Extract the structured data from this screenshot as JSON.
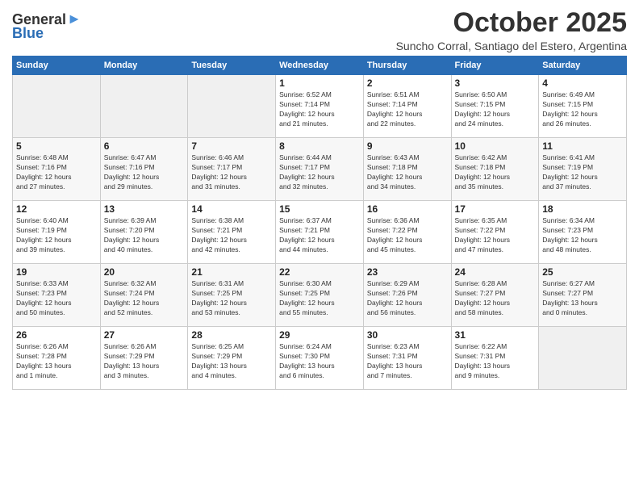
{
  "app": {
    "logo_line1": "General",
    "logo_line2": "Blue"
  },
  "header": {
    "month": "October 2025",
    "location": "Suncho Corral, Santiago del Estero, Argentina"
  },
  "days_of_week": [
    "Sunday",
    "Monday",
    "Tuesday",
    "Wednesday",
    "Thursday",
    "Friday",
    "Saturday"
  ],
  "weeks": [
    [
      {
        "day": "",
        "info": ""
      },
      {
        "day": "",
        "info": ""
      },
      {
        "day": "",
        "info": ""
      },
      {
        "day": "1",
        "info": "Sunrise: 6:52 AM\nSunset: 7:14 PM\nDaylight: 12 hours\nand 21 minutes."
      },
      {
        "day": "2",
        "info": "Sunrise: 6:51 AM\nSunset: 7:14 PM\nDaylight: 12 hours\nand 22 minutes."
      },
      {
        "day": "3",
        "info": "Sunrise: 6:50 AM\nSunset: 7:15 PM\nDaylight: 12 hours\nand 24 minutes."
      },
      {
        "day": "4",
        "info": "Sunrise: 6:49 AM\nSunset: 7:15 PM\nDaylight: 12 hours\nand 26 minutes."
      }
    ],
    [
      {
        "day": "5",
        "info": "Sunrise: 6:48 AM\nSunset: 7:16 PM\nDaylight: 12 hours\nand 27 minutes."
      },
      {
        "day": "6",
        "info": "Sunrise: 6:47 AM\nSunset: 7:16 PM\nDaylight: 12 hours\nand 29 minutes."
      },
      {
        "day": "7",
        "info": "Sunrise: 6:46 AM\nSunset: 7:17 PM\nDaylight: 12 hours\nand 31 minutes."
      },
      {
        "day": "8",
        "info": "Sunrise: 6:44 AM\nSunset: 7:17 PM\nDaylight: 12 hours\nand 32 minutes."
      },
      {
        "day": "9",
        "info": "Sunrise: 6:43 AM\nSunset: 7:18 PM\nDaylight: 12 hours\nand 34 minutes."
      },
      {
        "day": "10",
        "info": "Sunrise: 6:42 AM\nSunset: 7:18 PM\nDaylight: 12 hours\nand 35 minutes."
      },
      {
        "day": "11",
        "info": "Sunrise: 6:41 AM\nSunset: 7:19 PM\nDaylight: 12 hours\nand 37 minutes."
      }
    ],
    [
      {
        "day": "12",
        "info": "Sunrise: 6:40 AM\nSunset: 7:19 PM\nDaylight: 12 hours\nand 39 minutes."
      },
      {
        "day": "13",
        "info": "Sunrise: 6:39 AM\nSunset: 7:20 PM\nDaylight: 12 hours\nand 40 minutes."
      },
      {
        "day": "14",
        "info": "Sunrise: 6:38 AM\nSunset: 7:21 PM\nDaylight: 12 hours\nand 42 minutes."
      },
      {
        "day": "15",
        "info": "Sunrise: 6:37 AM\nSunset: 7:21 PM\nDaylight: 12 hours\nand 44 minutes."
      },
      {
        "day": "16",
        "info": "Sunrise: 6:36 AM\nSunset: 7:22 PM\nDaylight: 12 hours\nand 45 minutes."
      },
      {
        "day": "17",
        "info": "Sunrise: 6:35 AM\nSunset: 7:22 PM\nDaylight: 12 hours\nand 47 minutes."
      },
      {
        "day": "18",
        "info": "Sunrise: 6:34 AM\nSunset: 7:23 PM\nDaylight: 12 hours\nand 48 minutes."
      }
    ],
    [
      {
        "day": "19",
        "info": "Sunrise: 6:33 AM\nSunset: 7:23 PM\nDaylight: 12 hours\nand 50 minutes."
      },
      {
        "day": "20",
        "info": "Sunrise: 6:32 AM\nSunset: 7:24 PM\nDaylight: 12 hours\nand 52 minutes."
      },
      {
        "day": "21",
        "info": "Sunrise: 6:31 AM\nSunset: 7:25 PM\nDaylight: 12 hours\nand 53 minutes."
      },
      {
        "day": "22",
        "info": "Sunrise: 6:30 AM\nSunset: 7:25 PM\nDaylight: 12 hours\nand 55 minutes."
      },
      {
        "day": "23",
        "info": "Sunrise: 6:29 AM\nSunset: 7:26 PM\nDaylight: 12 hours\nand 56 minutes."
      },
      {
        "day": "24",
        "info": "Sunrise: 6:28 AM\nSunset: 7:27 PM\nDaylight: 12 hours\nand 58 minutes."
      },
      {
        "day": "25",
        "info": "Sunrise: 6:27 AM\nSunset: 7:27 PM\nDaylight: 13 hours\nand 0 minutes."
      }
    ],
    [
      {
        "day": "26",
        "info": "Sunrise: 6:26 AM\nSunset: 7:28 PM\nDaylight: 13 hours\nand 1 minute."
      },
      {
        "day": "27",
        "info": "Sunrise: 6:26 AM\nSunset: 7:29 PM\nDaylight: 13 hours\nand 3 minutes."
      },
      {
        "day": "28",
        "info": "Sunrise: 6:25 AM\nSunset: 7:29 PM\nDaylight: 13 hours\nand 4 minutes."
      },
      {
        "day": "29",
        "info": "Sunrise: 6:24 AM\nSunset: 7:30 PM\nDaylight: 13 hours\nand 6 minutes."
      },
      {
        "day": "30",
        "info": "Sunrise: 6:23 AM\nSunset: 7:31 PM\nDaylight: 13 hours\nand 7 minutes."
      },
      {
        "day": "31",
        "info": "Sunrise: 6:22 AM\nSunset: 7:31 PM\nDaylight: 13 hours\nand 9 minutes."
      },
      {
        "day": "",
        "info": ""
      }
    ]
  ]
}
